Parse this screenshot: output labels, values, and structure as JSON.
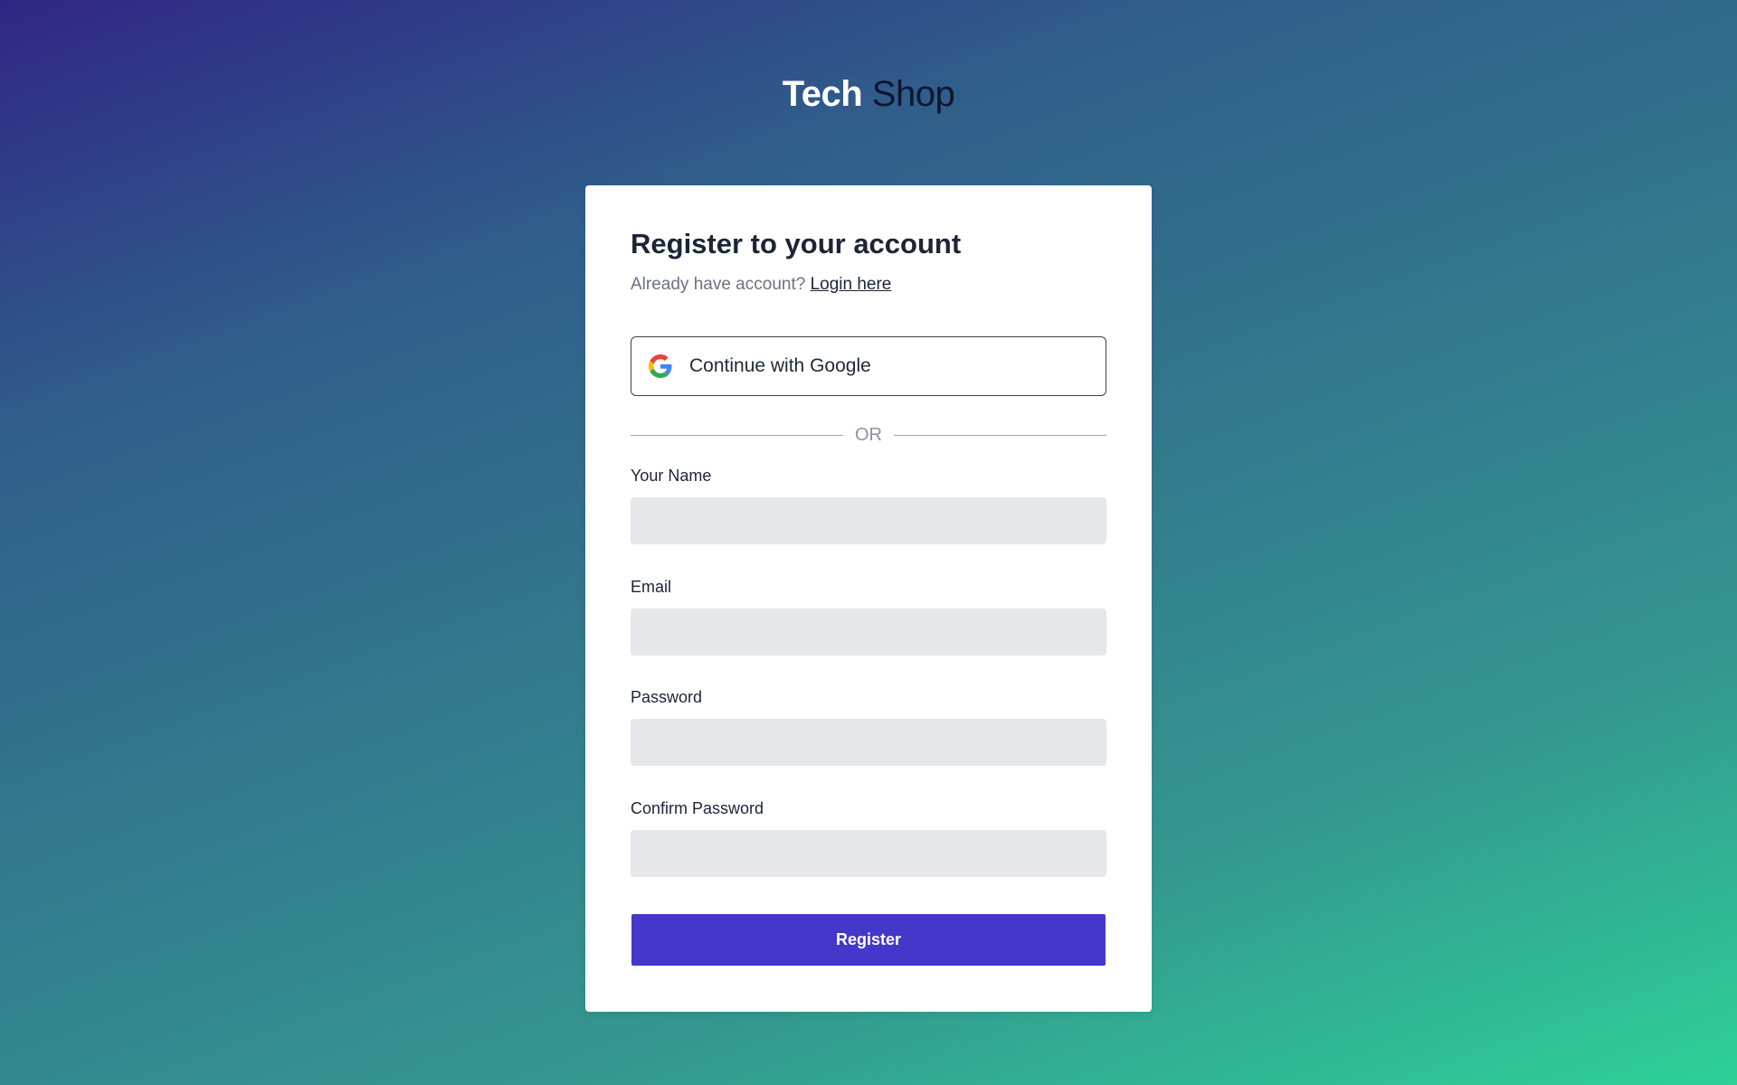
{
  "brand": {
    "name_bold": "Tech",
    "name_light": "Shop"
  },
  "register": {
    "title": "Register to your account",
    "subtitle": "Already have account?",
    "login_link": "Login here",
    "google_button": "Continue with Google",
    "google_icon": "google-icon",
    "divider_text": "OR",
    "fields": {
      "name_label": "Your Name",
      "name_value": "",
      "email_label": "Email",
      "email_value": "",
      "password_label": "Password",
      "password_value": "",
      "confirm_label": "Confirm Password",
      "confirm_value": ""
    },
    "submit_label": "Register"
  },
  "colors": {
    "primary": "#4338ca",
    "heading": "#1b2537",
    "muted": "#6b7280",
    "input_bg": "#e5e7eb",
    "gradient_start": "#302684",
    "gradient_end": "#2ed198"
  }
}
